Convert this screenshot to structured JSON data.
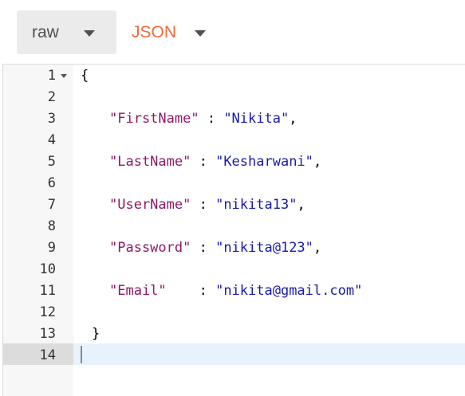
{
  "toolbar": {
    "format_label": "raw",
    "language_label": "JSON",
    "colors": {
      "accent": "#f26b3a",
      "dropdown_bg": "#ebebeb"
    }
  },
  "editor": {
    "line_numbers": [
      "1",
      "2",
      "3",
      "4",
      "5",
      "6",
      "7",
      "8",
      "9",
      "10",
      "11",
      "12",
      "13",
      "14"
    ],
    "open_brace": "{",
    "close_brace": "}",
    "fields": [
      {
        "key": "\"FirstName\"",
        "sep": " : ",
        "value": "\"Nikita\"",
        "trail": ","
      },
      {
        "key": "\"LastName\"",
        "sep": " : ",
        "value": "\"Kesharwani\"",
        "trail": ","
      },
      {
        "key": "\"UserName\"",
        "sep": " : ",
        "value": "\"nikita13\"",
        "trail": ","
      },
      {
        "key": "\"Password\"",
        "sep": " : ",
        "value": "\"nikita@123\"",
        "trail": ","
      },
      {
        "key": "\"Email\"",
        "sep": "    : ",
        "value": "\"nikita@gmail.com\"",
        "trail": ""
      }
    ],
    "active_line": "14",
    "colors": {
      "key": "#8b1a6b",
      "string": "#1a1aa6",
      "active_line": "#e8f2fe"
    }
  }
}
